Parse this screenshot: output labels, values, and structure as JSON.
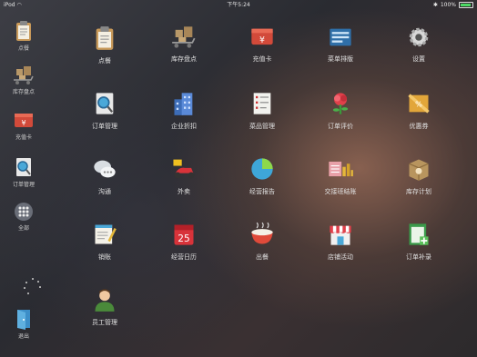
{
  "status_bar": {
    "carrier": "iPod",
    "time": "下午5:24",
    "battery": "100%"
  },
  "sidebar": {
    "items": [
      {
        "label": "点餐",
        "icon": "clipboard-icon"
      },
      {
        "label": "库存盘点",
        "icon": "inventory-cart-icon"
      },
      {
        "label": "充值卡",
        "icon": "recharge-card-icon"
      },
      {
        "label": "订单管理",
        "icon": "order-search-icon"
      },
      {
        "label": "全部",
        "icon": "grid-all-icon"
      }
    ],
    "exit_label": "退出"
  },
  "grid": {
    "rows": [
      [
        {
          "label": "点餐",
          "icon": "clipboard-icon"
        },
        {
          "label": "库存盘点",
          "icon": "inventory-cart-icon"
        },
        {
          "label": "充值卡",
          "icon": "recharge-card-icon"
        },
        {
          "label": "菜单排版",
          "icon": "menu-layout-icon"
        },
        {
          "label": "设置",
          "icon": "gear-icon"
        }
      ],
      [
        {
          "label": "订单管理",
          "icon": "order-search-icon"
        },
        {
          "label": "企业折扣",
          "icon": "building-icon"
        },
        {
          "label": "菜品管理",
          "icon": "dish-list-icon"
        },
        {
          "label": "订单评价",
          "icon": "rose-icon"
        },
        {
          "label": "优惠券",
          "icon": "coupon-icon"
        }
      ],
      [
        {
          "label": "沟通",
          "icon": "chat-bubbles-icon"
        },
        {
          "label": "外卖",
          "icon": "scooter-icon"
        },
        {
          "label": "经营报告",
          "icon": "pie-chart-icon"
        },
        {
          "label": "交接班结账",
          "icon": "cash-register-icon"
        },
        {
          "label": "库存计划",
          "icon": "box-plan-icon"
        }
      ],
      [
        {
          "label": "销账",
          "icon": "notepad-icon"
        },
        {
          "label": "经营日历",
          "icon": "calendar-icon"
        },
        {
          "label": "出餐",
          "icon": "bowl-icon"
        },
        {
          "label": "店铺活动",
          "icon": "storefront-icon"
        },
        {
          "label": "订单补录",
          "icon": "order-supplement-icon"
        }
      ],
      [
        {
          "label": "员工管理",
          "icon": "staff-icon"
        }
      ]
    ],
    "calendar_day": "25"
  }
}
